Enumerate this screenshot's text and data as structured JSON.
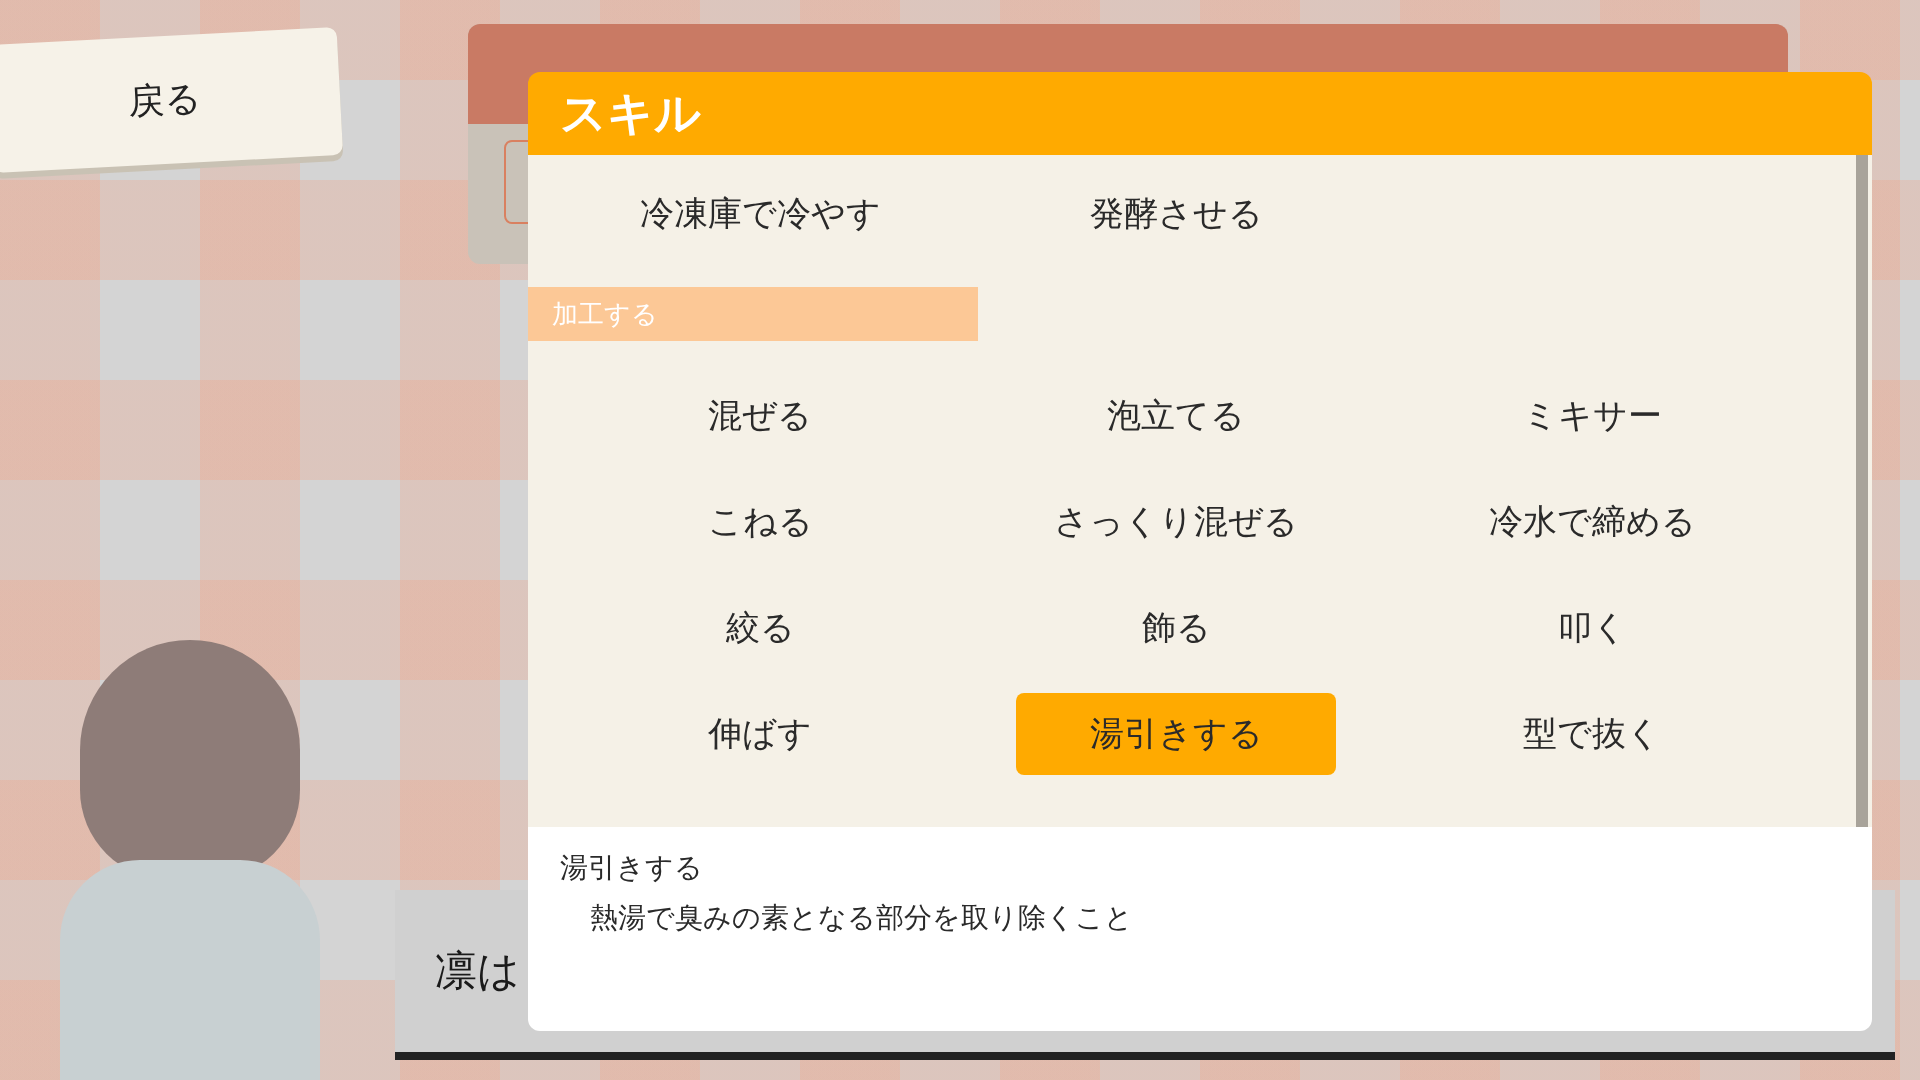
{
  "back_button": {
    "label": "戻る"
  },
  "dialogue": {
    "text": "凛は"
  },
  "skill_dialog": {
    "title": "スキル",
    "sections": [
      {
        "items": [
          {
            "label": "冷凍庫で冷やす",
            "selected": false
          },
          {
            "label": "発酵させる",
            "selected": false
          }
        ]
      },
      {
        "heading": "加工する",
        "items": [
          {
            "label": "混ぜる",
            "selected": false
          },
          {
            "label": "泡立てる",
            "selected": false
          },
          {
            "label": "ミキサー",
            "selected": false
          },
          {
            "label": "こねる",
            "selected": false
          },
          {
            "label": "さっくり混ぜる",
            "selected": false
          },
          {
            "label": "冷水で締める",
            "selected": false
          },
          {
            "label": "絞る",
            "selected": false
          },
          {
            "label": "飾る",
            "selected": false
          },
          {
            "label": "叩く",
            "selected": false
          },
          {
            "label": "伸ばす",
            "selected": false
          },
          {
            "label": "湯引きする",
            "selected": true
          },
          {
            "label": "型で抜く",
            "selected": false
          }
        ]
      }
    ],
    "description": {
      "title": "湯引きする",
      "text": "熱湯で臭みの素となる部分を取り除くこと"
    }
  }
}
